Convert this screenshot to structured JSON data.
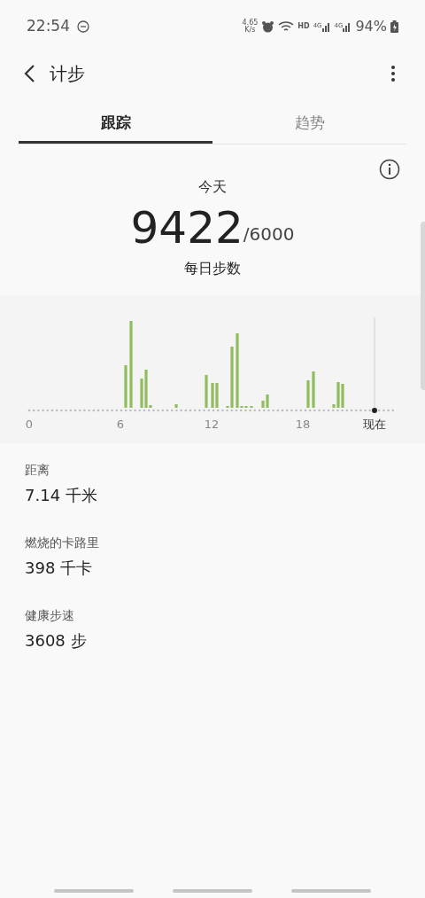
{
  "status_bar": {
    "time": "22:54",
    "net_speed": "4.65",
    "net_unit": "K/s",
    "hd": "HD",
    "signal_labels": [
      "4G",
      "4G"
    ],
    "battery": "94%"
  },
  "header": {
    "title": "计步"
  },
  "tabs": [
    {
      "label": "跟踪",
      "selected": true
    },
    {
      "label": "趋势",
      "selected": false
    }
  ],
  "summary": {
    "day": "今天",
    "steps": "9422",
    "goal": "/6000",
    "caption": "每日步数"
  },
  "chart": {
    "x_labels": [
      "0",
      "6",
      "12",
      "18",
      "现在"
    ]
  },
  "stats": [
    {
      "label": "距离",
      "value": "7.14 千米"
    },
    {
      "label": "燃烧的卡路里",
      "value": "398 千卡"
    },
    {
      "label": "健康步速",
      "value": "3608 步"
    }
  ]
}
